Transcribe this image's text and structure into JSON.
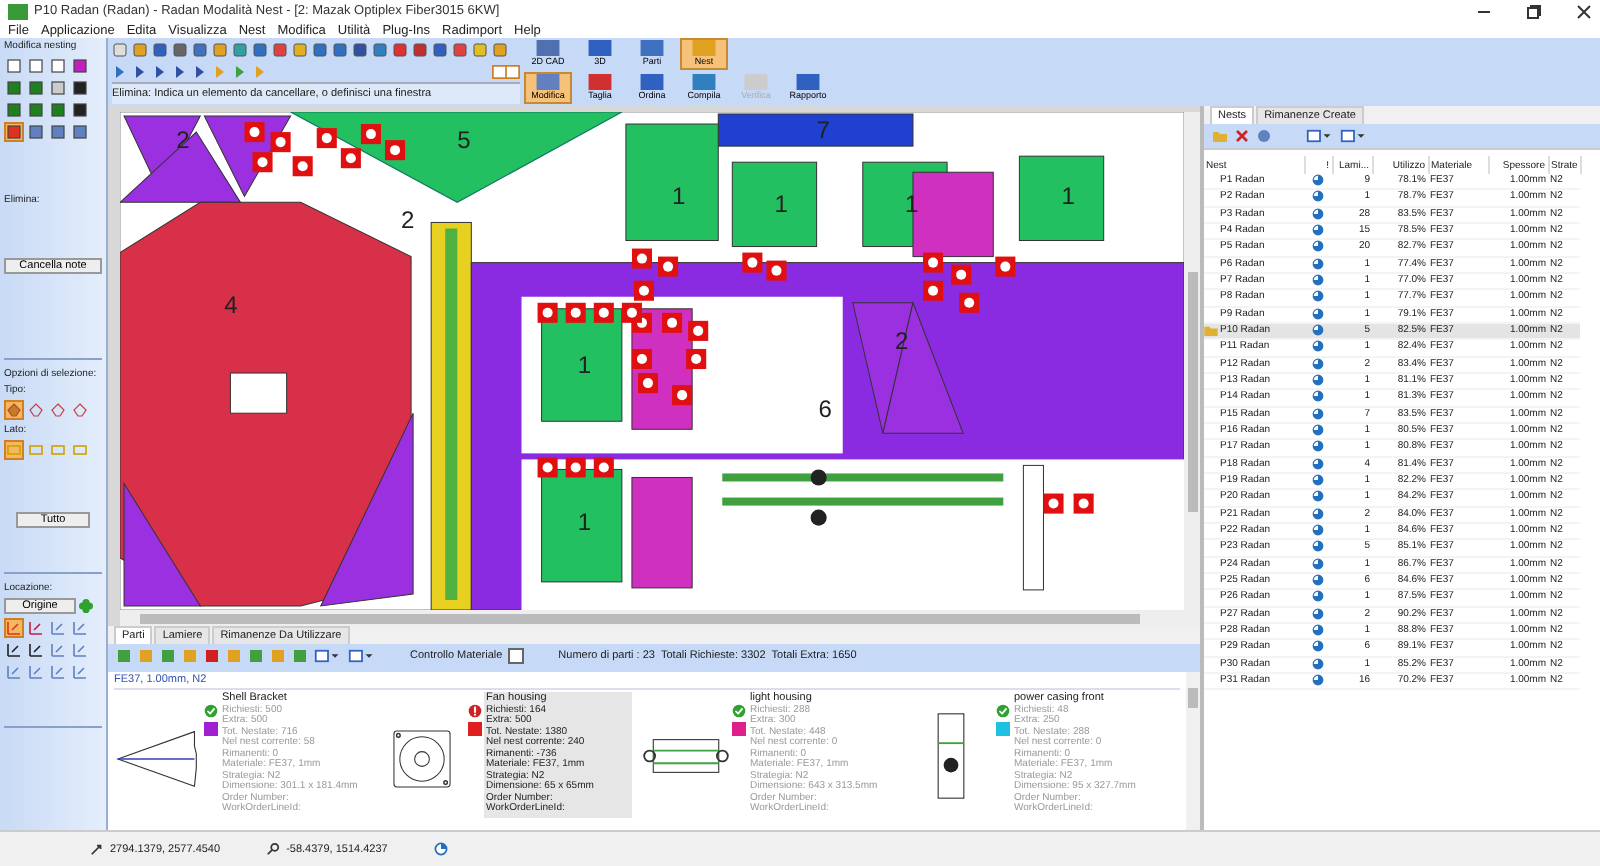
{
  "window": {
    "title": "P10 Radan (Radan) - Radan Modalità Nest - [2: Mazak Optiplex Fiber3015 6KW]"
  },
  "menu": [
    "File",
    "Applicazione",
    "Edita",
    "Visualizza",
    "Nest",
    "Modifica",
    "Utilità",
    "Plug-Ins",
    "Radimport",
    "Help"
  ],
  "left_panel": {
    "title": "Modifica nesting",
    "tools": [
      {
        "selected": false
      },
      {
        "selected": false
      },
      {
        "selected": false
      },
      {
        "selected": false
      },
      {
        "selected": false
      },
      {
        "selected": false
      },
      {
        "selected": false
      },
      {
        "selected": false
      },
      {
        "selected": false
      },
      {
        "selected": false
      },
      {
        "selected": false
      },
      {
        "selected": false
      },
      {
        "selected": true
      },
      {
        "selected": false
      },
      {
        "selected": false
      },
      {
        "selected": false
      }
    ],
    "delete_label": "Elimina:",
    "delete_button": "Cancella note",
    "selection_title": "Opzioni di selezione:",
    "type_label": "Tipo:",
    "type_tools": [
      {
        "selected": true
      },
      {
        "selected": false
      },
      {
        "selected": false
      },
      {
        "selected": false
      }
    ],
    "side_label": "Lato:",
    "side_tools": [
      {
        "selected": true
      },
      {
        "selected": false
      },
      {
        "selected": false
      },
      {
        "selected": false
      }
    ],
    "all_button": "Tutto",
    "location_title": "Locazione:",
    "origin_button": "Origine",
    "location_tools": [
      {
        "selected": true
      },
      {
        "selected": false
      },
      {
        "selected": false
      },
      {
        "selected": false
      },
      {
        "selected": false
      },
      {
        "selected": false
      },
      {
        "selected": false
      },
      {
        "selected": false
      },
      {
        "selected": false
      },
      {
        "selected": false
      },
      {
        "selected": false
      },
      {
        "selected": false
      }
    ]
  },
  "mode_buttons": [
    {
      "label": "2D CAD",
      "selected": false,
      "disabled": false
    },
    {
      "label": "3D",
      "selected": false,
      "disabled": false
    },
    {
      "label": "Parti",
      "selected": false,
      "disabled": false
    },
    {
      "label": "Nest",
      "selected": true,
      "disabled": false
    }
  ],
  "nest_buttons": [
    {
      "label": "Modifica",
      "selected": true,
      "disabled": false
    },
    {
      "label": "Taglia",
      "selected": false,
      "disabled": false
    },
    {
      "label": "Ordina",
      "selected": false,
      "disabled": false
    },
    {
      "label": "Compila",
      "selected": false,
      "disabled": false
    },
    {
      "label": "Verifica",
      "selected": false,
      "disabled": true
    },
    {
      "label": "Rapporto",
      "selected": false,
      "disabled": false
    }
  ],
  "hint": "Elimina: Indica un elemento da cancellare, o definisci una finestra",
  "nest_labels": [
    "2",
    "2",
    "5",
    "4",
    "1",
    "1",
    "1",
    "1",
    "1",
    "7",
    "6",
    "2",
    "1"
  ],
  "parts_panel": {
    "tabs": [
      {
        "label": "Parti",
        "selected": true
      },
      {
        "label": "Lamiere",
        "selected": false
      },
      {
        "label": "Rimanenze Da Utilizzare",
        "selected": false
      }
    ],
    "material_check_label": "Controllo Materiale",
    "material_check": false,
    "part_count": "Numero di parti : 23",
    "total_required": "Totali Richieste: 3302",
    "total_extra": "Totali Extra: 1650",
    "group": "FE37, 1.00mm, N2",
    "parts": [
      {
        "kind": "bracket",
        "name": "Shell Bracket",
        "ok": true,
        "color": "#a020d0",
        "selected": false,
        "details": [
          "Richiesti: 500",
          "Extra: 500",
          "Tot. Nestate: 716",
          "Nel nest corrente: 58",
          "Rimanenti: 0",
          "Materiale: FE37, 1mm",
          "Strategia: N2",
          "Dimensione: 301.1 x 181.4mm",
          "Order Number:",
          "WorkOrderLineId:"
        ]
      },
      {
        "kind": "fan",
        "name": "Fan housing",
        "ok": false,
        "color": "#e02020",
        "selected": true,
        "details": [
          "Richiesti: 164",
          "Extra: 500",
          "Tot. Nestate: 1380",
          "Nel nest corrente: 240",
          "Rimanenti: -736",
          "Materiale: FE37, 1mm",
          "Strategia: N2",
          "Dimensione: 65 x 65mm",
          "Order Number:",
          "WorkOrderLineId:"
        ]
      },
      {
        "kind": "light",
        "name": "light housing",
        "ok": true,
        "color": "#e0208a",
        "selected": false,
        "details": [
          "Richiesti: 288",
          "Extra: 300",
          "Tot. Nestate: 448",
          "Nel nest corrente: 0",
          "Rimanenti: 0",
          "Materiale: FE37, 1mm",
          "Strategia: N2",
          "Dimensione: 643 x 313.5mm",
          "Order Number:",
          "WorkOrderLineId:"
        ]
      },
      {
        "kind": "casing",
        "name": "power casing front",
        "ok": true,
        "color": "#20c0e0",
        "selected": false,
        "details": [
          "Richiesti: 48",
          "Extra: 250",
          "Tot. Nestate: 288",
          "Nel nest corrente: 0",
          "Rimanenti: 0",
          "Materiale: FE37, 1mm",
          "Strategia: N2",
          "Dimensione: 95 x 327.7mm",
          "Order Number:",
          "WorkOrderLineId:"
        ]
      }
    ]
  },
  "nests_panel": {
    "tabs": [
      {
        "label": "Nests",
        "selected": true
      },
      {
        "label": "Rimanenze Create",
        "selected": false
      }
    ],
    "columns": [
      "Nest",
      "!",
      "Lami...",
      "Utilizzo",
      "Materiale",
      "Spessore",
      "Strate"
    ],
    "rows": [
      {
        "nest": "P1 Radan",
        "sheets": "9",
        "usage": "78.1%",
        "material": "FE37",
        "thickness": "1.00mm",
        "strategy": "N2",
        "selected": false
      },
      {
        "nest": "P2 Radan",
        "sheets": "1",
        "usage": "78.7%",
        "material": "FE37",
        "thickness": "1.00mm",
        "strategy": "N2",
        "selected": false
      },
      {
        "nest": "P3 Radan",
        "sheets": "28",
        "usage": "83.5%",
        "material": "FE37",
        "thickness": "1.00mm",
        "strategy": "N2",
        "selected": false
      },
      {
        "nest": "P4 Radan",
        "sheets": "15",
        "usage": "78.5%",
        "material": "FE37",
        "thickness": "1.00mm",
        "strategy": "N2",
        "selected": false
      },
      {
        "nest": "P5 Radan",
        "sheets": "20",
        "usage": "82.7%",
        "material": "FE37",
        "thickness": "1.00mm",
        "strategy": "N2",
        "selected": false
      },
      {
        "nest": "P6 Radan",
        "sheets": "1",
        "usage": "77.4%",
        "material": "FE37",
        "thickness": "1.00mm",
        "strategy": "N2",
        "selected": false
      },
      {
        "nest": "P7 Radan",
        "sheets": "1",
        "usage": "77.0%",
        "material": "FE37",
        "thickness": "1.00mm",
        "strategy": "N2",
        "selected": false
      },
      {
        "nest": "P8 Radan",
        "sheets": "1",
        "usage": "77.7%",
        "material": "FE37",
        "thickness": "1.00mm",
        "strategy": "N2",
        "selected": false
      },
      {
        "nest": "P9 Radan",
        "sheets": "1",
        "usage": "79.1%",
        "material": "FE37",
        "thickness": "1.00mm",
        "strategy": "N2",
        "selected": false
      },
      {
        "nest": "P10 Radan",
        "sheets": "5",
        "usage": "82.5%",
        "material": "FE37",
        "thickness": "1.00mm",
        "strategy": "N2",
        "selected": true
      },
      {
        "nest": "P11 Radan",
        "sheets": "1",
        "usage": "82.4%",
        "material": "FE37",
        "thickness": "1.00mm",
        "strategy": "N2",
        "selected": false
      },
      {
        "nest": "P12 Radan",
        "sheets": "2",
        "usage": "83.4%",
        "material": "FE37",
        "thickness": "1.00mm",
        "strategy": "N2",
        "selected": false
      },
      {
        "nest": "P13 Radan",
        "sheets": "1",
        "usage": "81.1%",
        "material": "FE37",
        "thickness": "1.00mm",
        "strategy": "N2",
        "selected": false
      },
      {
        "nest": "P14 Radan",
        "sheets": "1",
        "usage": "81.3%",
        "material": "FE37",
        "thickness": "1.00mm",
        "strategy": "N2",
        "selected": false
      },
      {
        "nest": "P15 Radan",
        "sheets": "7",
        "usage": "83.5%",
        "material": "FE37",
        "thickness": "1.00mm",
        "strategy": "N2",
        "selected": false
      },
      {
        "nest": "P16 Radan",
        "sheets": "1",
        "usage": "80.5%",
        "material": "FE37",
        "thickness": "1.00mm",
        "strategy": "N2",
        "selected": false
      },
      {
        "nest": "P17 Radan",
        "sheets": "1",
        "usage": "80.8%",
        "material": "FE37",
        "thickness": "1.00mm",
        "strategy": "N2",
        "selected": false
      },
      {
        "nest": "P18 Radan",
        "sheets": "4",
        "usage": "81.4%",
        "material": "FE37",
        "thickness": "1.00mm",
        "strategy": "N2",
        "selected": false
      },
      {
        "nest": "P19 Radan",
        "sheets": "1",
        "usage": "82.2%",
        "material": "FE37",
        "thickness": "1.00mm",
        "strategy": "N2",
        "selected": false
      },
      {
        "nest": "P20 Radan",
        "sheets": "1",
        "usage": "84.2%",
        "material": "FE37",
        "thickness": "1.00mm",
        "strategy": "N2",
        "selected": false
      },
      {
        "nest": "P21 Radan",
        "sheets": "2",
        "usage": "84.0%",
        "material": "FE37",
        "thickness": "1.00mm",
        "strategy": "N2",
        "selected": false
      },
      {
        "nest": "P22 Radan",
        "sheets": "1",
        "usage": "84.6%",
        "material": "FE37",
        "thickness": "1.00mm",
        "strategy": "N2",
        "selected": false
      },
      {
        "nest": "P23 Radan",
        "sheets": "5",
        "usage": "85.1%",
        "material": "FE37",
        "thickness": "1.00mm",
        "strategy": "N2",
        "selected": false
      },
      {
        "nest": "P24 Radan",
        "sheets": "1",
        "usage": "86.7%",
        "material": "FE37",
        "thickness": "1.00mm",
        "strategy": "N2",
        "selected": false
      },
      {
        "nest": "P25 Radan",
        "sheets": "6",
        "usage": "84.6%",
        "material": "FE37",
        "thickness": "1.00mm",
        "strategy": "N2",
        "selected": false
      },
      {
        "nest": "P26 Radan",
        "sheets": "1",
        "usage": "87.5%",
        "material": "FE37",
        "thickness": "1.00mm",
        "strategy": "N2",
        "selected": false
      },
      {
        "nest": "P27 Radan",
        "sheets": "2",
        "usage": "90.2%",
        "material": "FE37",
        "thickness": "1.00mm",
        "strategy": "N2",
        "selected": false
      },
      {
        "nest": "P28 Radan",
        "sheets": "1",
        "usage": "88.8%",
        "material": "FE37",
        "thickness": "1.00mm",
        "strategy": "N2",
        "selected": false
      },
      {
        "nest": "P29 Radan",
        "sheets": "6",
        "usage": "89.1%",
        "material": "FE37",
        "thickness": "1.00mm",
        "strategy": "N2",
        "selected": false
      },
      {
        "nest": "P30 Radan",
        "sheets": "1",
        "usage": "85.2%",
        "material": "FE37",
        "thickness": "1.00mm",
        "strategy": "N2",
        "selected": false
      },
      {
        "nest": "P31 Radan",
        "sheets": "16",
        "usage": "70.2%",
        "material": "FE37",
        "thickness": "1.00mm",
        "strategy": "N2",
        "selected": false
      }
    ]
  },
  "status_bar": {
    "cursor": "2794.1379, 2577.4540",
    "offset": "-58.4379, 1514.4237"
  }
}
